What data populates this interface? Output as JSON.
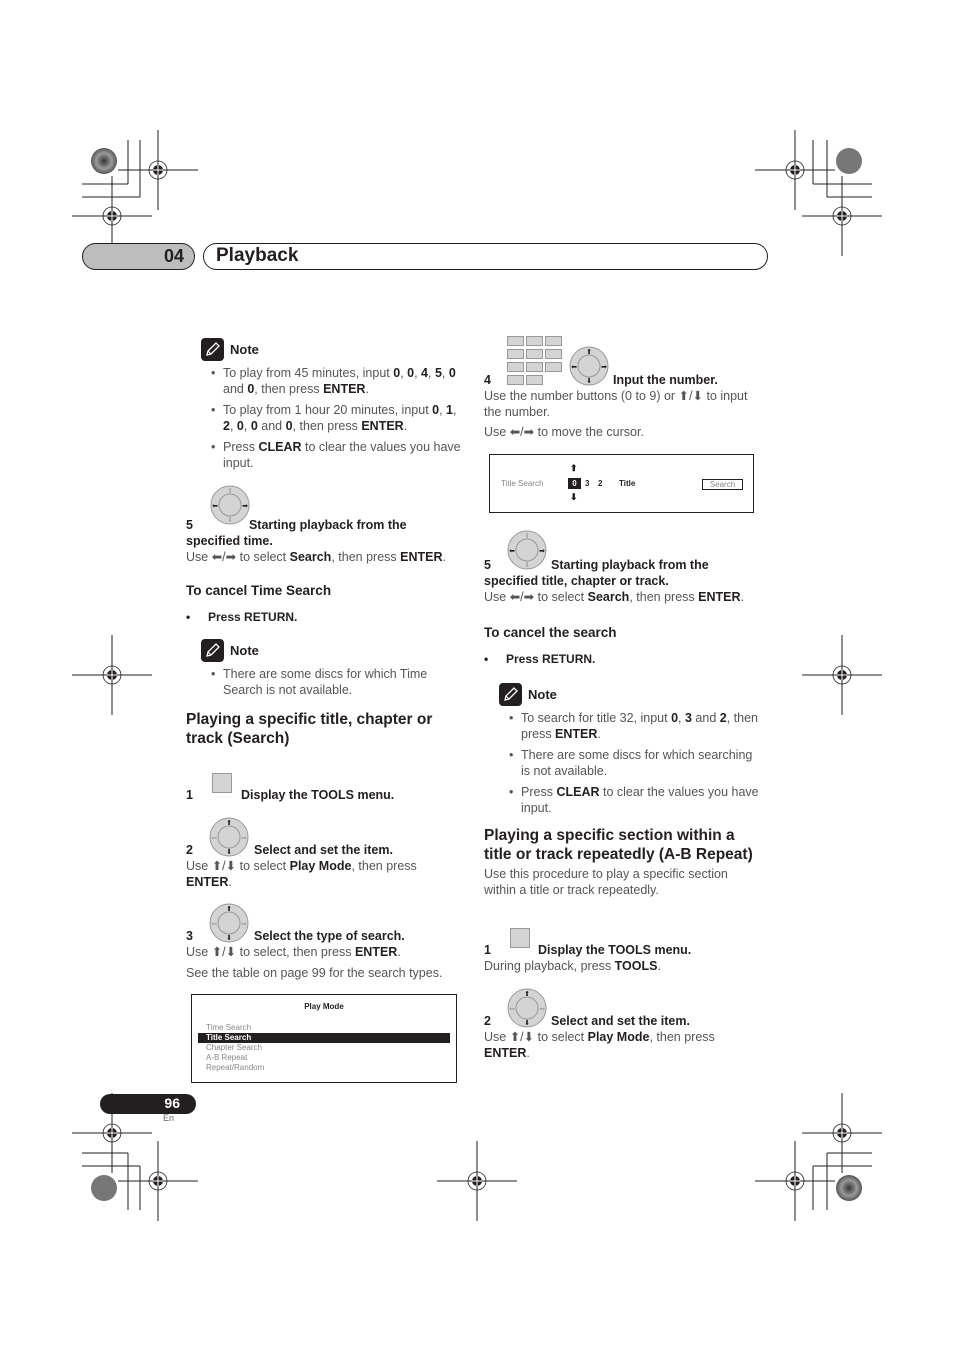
{
  "header": {
    "chapter_number": "04",
    "chapter_title": "Playback"
  },
  "left_column": {
    "note1": {
      "label": "Note",
      "items": [
        {
          "parts": [
            [
              "To play from 45 minutes, input ",
              false
            ],
            [
              "0",
              true
            ],
            [
              ", ",
              false
            ],
            [
              "0",
              true
            ],
            [
              ", ",
              false
            ],
            [
              "4",
              true
            ],
            [
              ", ",
              false
            ],
            [
              "5",
              true
            ],
            [
              ", ",
              false
            ],
            [
              "0",
              true
            ],
            [
              " and ",
              false
            ],
            [
              "0",
              true
            ],
            [
              ", then press ",
              false
            ],
            [
              "ENTER",
              true
            ],
            [
              ".",
              false
            ]
          ]
        },
        {
          "parts": [
            [
              "To play from 1 hour 20 minutes, input ",
              false
            ],
            [
              "0",
              true
            ],
            [
              ", ",
              false
            ],
            [
              "1",
              true
            ],
            [
              ", ",
              false
            ],
            [
              "2",
              true
            ],
            [
              ", ",
              false
            ],
            [
              "0",
              true
            ],
            [
              ", ",
              false
            ],
            [
              "0",
              true
            ],
            [
              " and ",
              false
            ],
            [
              "0",
              true
            ],
            [
              ", then press ",
              false
            ],
            [
              "ENTER",
              true
            ],
            [
              ".",
              false
            ]
          ]
        },
        {
          "parts": [
            [
              "Press ",
              false
            ],
            [
              "CLEAR",
              true
            ],
            [
              " to clear the values you have input.",
              false
            ]
          ]
        }
      ]
    },
    "step5": {
      "number": "5",
      "title_a": "Starting playback from the",
      "title_b": "specified time.",
      "desc_parts": [
        [
          "Use ",
          false
        ],
        [
          "⬅/➡",
          false
        ],
        [
          " to select ",
          false
        ],
        [
          "Search",
          true
        ],
        [
          ", then press ",
          false
        ],
        [
          "ENTER",
          true
        ],
        [
          ".",
          false
        ]
      ]
    },
    "cancel_heading": "To cancel Time Search",
    "cancel_bullet": "Press RETURN.",
    "note2": {
      "label": "Note",
      "items": [
        {
          "parts": [
            [
              "There are some discs for which Time Search is not available.",
              false
            ]
          ]
        }
      ]
    },
    "section_heading": "Playing a specific title, chapter or track (Search)",
    "step1": {
      "number": "1",
      "title": "Display the TOOLS menu."
    },
    "step2": {
      "number": "2",
      "title": "Select and set the item.",
      "desc_parts": [
        [
          "Use ",
          false
        ],
        [
          "⬆/⬇",
          false
        ],
        [
          " to select ",
          false
        ],
        [
          "Play Mode",
          true
        ],
        [
          ", then press ",
          false
        ],
        [
          "ENTER",
          true
        ],
        [
          ".",
          false
        ]
      ]
    },
    "step3": {
      "number": "3",
      "title": "Select the type of search.",
      "desc_parts": [
        [
          "Use ",
          false
        ],
        [
          "⬆/⬇",
          false
        ],
        [
          " to select, then press ",
          false
        ],
        [
          "ENTER",
          true
        ],
        [
          ".",
          false
        ]
      ],
      "extra": "See the table on page 99 for the search types."
    },
    "play_mode_screen": {
      "title": "Play Mode",
      "items": [
        "Time Search",
        "Title Search",
        "Chapter Search",
        "A-B Repeat",
        "Repeat/Random"
      ],
      "selected_index": 1
    }
  },
  "right_column": {
    "step4": {
      "number": "4",
      "title": "Input the number.",
      "desc1_parts": [
        [
          "Use the number buttons (0 to 9) or ",
          false
        ],
        [
          "⬆/⬇",
          false
        ],
        [
          " to input the number.",
          false
        ]
      ],
      "desc2_parts": [
        [
          "Use ",
          false
        ],
        [
          "⬅/➡",
          false
        ],
        [
          " to move the cursor.",
          false
        ]
      ]
    },
    "title_search_screen": {
      "label": "Title Search",
      "digits": [
        "0",
        "3",
        "2"
      ],
      "active_digit_index": 0,
      "unit": "Title",
      "button": "Search",
      "arrow_up": "⬆",
      "arrow_down": "⬇"
    },
    "step5": {
      "number": "5",
      "title_a": "Starting playback from the",
      "title_b": "specified title, chapter or track.",
      "desc_parts": [
        [
          "Use ",
          false
        ],
        [
          "⬅/➡",
          false
        ],
        [
          " to select ",
          false
        ],
        [
          "Search",
          true
        ],
        [
          ", then press ",
          false
        ],
        [
          "ENTER",
          true
        ],
        [
          ".",
          false
        ]
      ]
    },
    "cancel_heading": "To cancel the search",
    "cancel_bullet": "Press RETURN.",
    "note": {
      "label": "Note",
      "items": [
        {
          "parts": [
            [
              "To search for title 32, input ",
              false
            ],
            [
              "0",
              true
            ],
            [
              ", ",
              false
            ],
            [
              "3",
              true
            ],
            [
              " and ",
              false
            ],
            [
              "2",
              true
            ],
            [
              ", then press ",
              false
            ],
            [
              "ENTER",
              true
            ],
            [
              ".",
              false
            ]
          ]
        },
        {
          "parts": [
            [
              "There are some discs for which searching is not available.",
              false
            ]
          ]
        },
        {
          "parts": [
            [
              "Press ",
              false
            ],
            [
              "CLEAR",
              true
            ],
            [
              " to clear the values you have input.",
              false
            ]
          ]
        }
      ]
    },
    "section_heading": "Playing a specific section within a title or track repeatedly (A-B Repeat)",
    "section_intro": "Use this procedure to play a specific section within a title or track repeatedly.",
    "step1": {
      "number": "1",
      "title": "Display the TOOLS menu.",
      "desc_parts": [
        [
          "During playback, press ",
          false
        ],
        [
          "TOOLS",
          true
        ],
        [
          ".",
          false
        ]
      ]
    },
    "step2": {
      "number": "2",
      "title": "Select and set the item.",
      "desc_parts": [
        [
          "Use ",
          false
        ],
        [
          "⬆/⬇",
          false
        ],
        [
          " to select ",
          false
        ],
        [
          "Play Mode",
          true
        ],
        [
          ", then press ",
          false
        ],
        [
          "ENTER",
          true
        ],
        [
          ".",
          false
        ]
      ]
    }
  },
  "footer": {
    "page_number": "96",
    "language": "En"
  }
}
